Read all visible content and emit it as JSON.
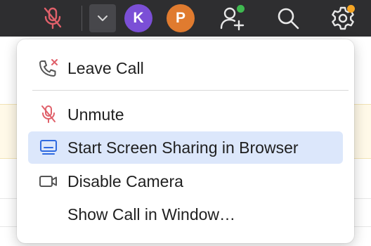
{
  "toolbar": {
    "avatars": [
      {
        "initial": "K",
        "color": "#7b4fd6"
      },
      {
        "initial": "P",
        "color": "#e07b2f"
      }
    ],
    "colors": {
      "mic_muted": "#e0606a",
      "icons": "#e8e8e8",
      "add_user_badge": "#3fb950",
      "settings_badge": "#f5a524"
    }
  },
  "menu": {
    "items": [
      {
        "label": "Leave Call",
        "icon": "phone-hangup-icon"
      },
      {
        "label": "Unmute",
        "icon": "mic-off-icon"
      },
      {
        "label": "Start Screen Sharing in Browser",
        "icon": "screen-share-icon",
        "highlighted": true
      },
      {
        "label": "Disable Camera",
        "icon": "camera-icon"
      },
      {
        "label": "Show Call in Window…",
        "icon": ""
      }
    ],
    "highlight_color": "#dce7fb"
  }
}
